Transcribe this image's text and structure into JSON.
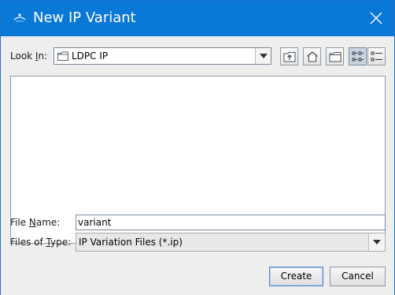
{
  "window": {
    "title": "New IP Variant"
  },
  "look_in": {
    "label_prefix": "Look ",
    "label_mnemonic": "I",
    "label_suffix": "n:",
    "value": "LDPC IP"
  },
  "toolbar": {
    "up_one_level": "up-folder-icon",
    "home": "home-icon",
    "new_folder": "new-folder-icon",
    "list_view": "list-view-icon",
    "details_view": "details-view-icon"
  },
  "file_list": {
    "items": []
  },
  "file_name": {
    "label_prefix": "File ",
    "label_mnemonic": "N",
    "label_suffix": "ame:",
    "value": "variant"
  },
  "files_of_type": {
    "label_prefix": "Files of ",
    "label_mnemonic": "T",
    "label_suffix": "ype:",
    "value": "IP Variation Files (*.ip)"
  },
  "buttons": {
    "create": "Create",
    "cancel": "Cancel"
  },
  "colors": {
    "titlebar": "#0a78d7",
    "dialog_bg": "#eeeeee",
    "default_button_border": "#5b8bc9"
  }
}
